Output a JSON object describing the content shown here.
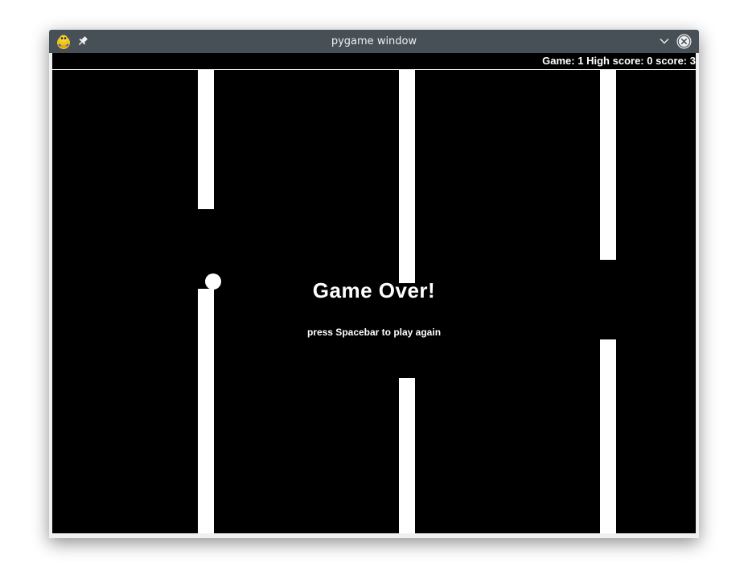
{
  "window": {
    "title": "pygame window"
  },
  "hud": {
    "game_label": "Game:",
    "game_value": "1",
    "high_score_label": "High score:",
    "high_score_value": "0",
    "score_label": "score:",
    "score_value": "3"
  },
  "overlay": {
    "title": "Game Over!",
    "hint": "press Spacebar to play again"
  },
  "colors": {
    "titlebar": "#475057",
    "canvas": "#000000",
    "foreground": "#ffffff"
  },
  "icons": {
    "app": "pygame-snake-icon",
    "pin": "pin-icon",
    "minimize": "chevron-down-icon",
    "close": "close-icon"
  }
}
